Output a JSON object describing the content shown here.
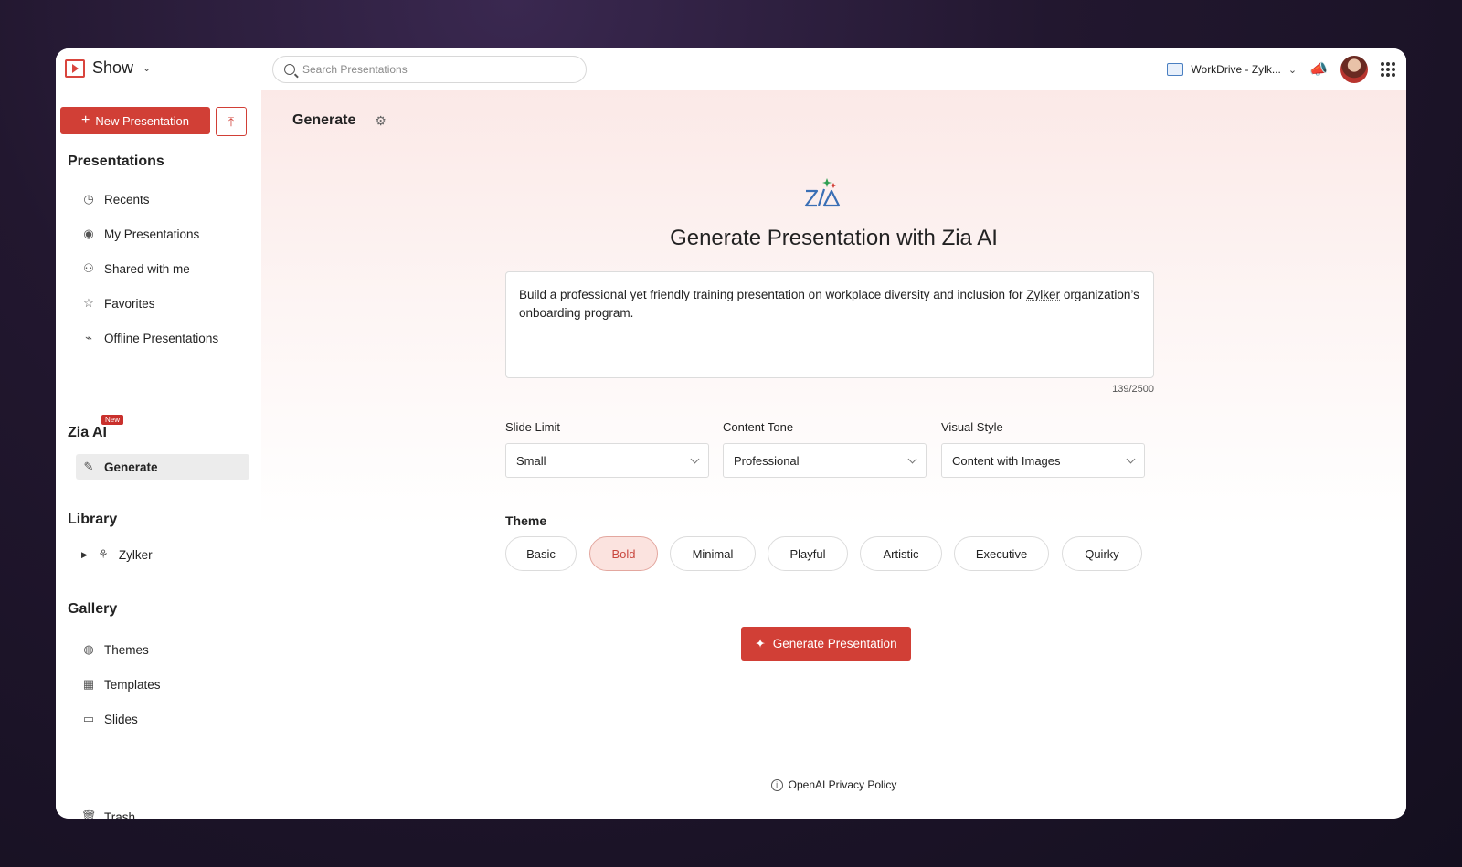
{
  "app": {
    "name": "Show"
  },
  "search": {
    "placeholder": "Search Presentations"
  },
  "topbar": {
    "workdrive": "WorkDrive - Zylk..."
  },
  "sidebar": {
    "new_presentation": "New Presentation",
    "sections": {
      "presentations": "Presentations",
      "zia": "Zia AI",
      "zia_badge": "New",
      "library": "Library",
      "gallery": "Gallery"
    },
    "presentation_items": [
      "Recents",
      "My Presentations",
      "Shared with me",
      "Favorites",
      "Offline Presentations"
    ],
    "zia_items": [
      "Generate"
    ],
    "library_items": [
      "Zylker"
    ],
    "gallery_items": [
      "Themes",
      "Templates",
      "Slides"
    ],
    "trash": "Trash"
  },
  "main": {
    "breadcrumb": "Generate",
    "heading": "Generate Presentation with Zia AI",
    "prompt_before": "Build a professional yet friendly training presentation on workplace diversity and inclusion for ",
    "prompt_link": "Zylker",
    "prompt_after": " organization’s onboarding program.",
    "char_count": "139/2500",
    "fields": [
      {
        "label": "Slide Limit",
        "value": "Small"
      },
      {
        "label": "Content Tone",
        "value": "Professional"
      },
      {
        "label": "Visual Style",
        "value": "Content with Images"
      }
    ],
    "theme_label": "Theme",
    "themes": [
      "Basic",
      "Bold",
      "Minimal",
      "Playful",
      "Artistic",
      "Executive",
      "Quirky"
    ],
    "selected_theme": "Bold",
    "generate_button": "Generate Presentation",
    "footer_link": "OpenAI Privacy Policy"
  },
  "colors": {
    "accent": "#d13f36",
    "selected_chip_bg": "#fbe3df"
  }
}
